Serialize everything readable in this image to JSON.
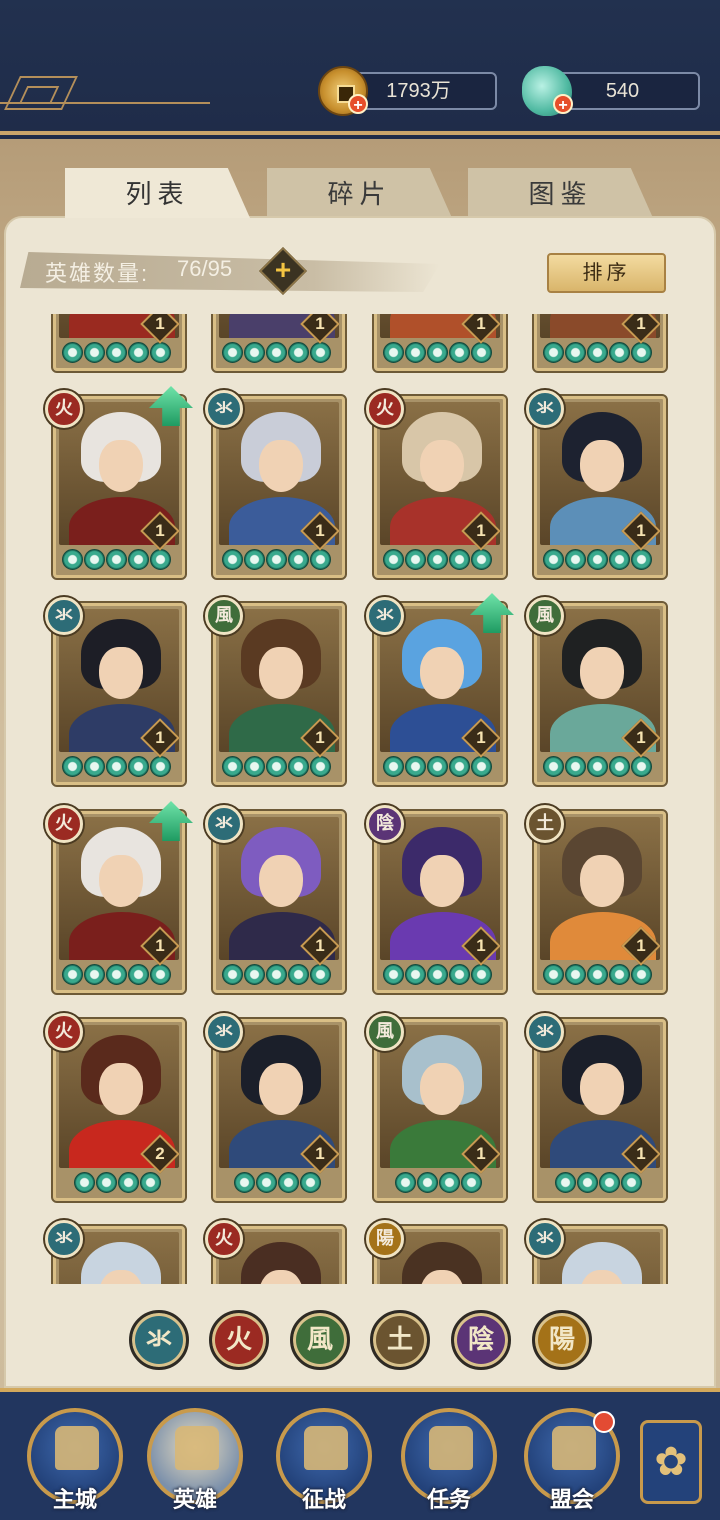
{
  "resources": {
    "coins": "1793万",
    "jade": "540"
  },
  "tabs": [
    "列表",
    "碎片",
    "图鉴"
  ],
  "hero_count": {
    "label": "英雄数量:",
    "value": "76/95"
  },
  "sort_label": "排序",
  "element_filters": [
    {
      "glyph": "氺",
      "name": "water",
      "color": "#2d6c77"
    },
    {
      "glyph": "火",
      "name": "fire",
      "color": "#9b2a22"
    },
    {
      "glyph": "風",
      "name": "wind",
      "color": "#3f6d3a"
    },
    {
      "glyph": "土",
      "name": "earth",
      "color": "#6b5430"
    },
    {
      "glyph": "陰",
      "name": "yin",
      "color": "#5b3476"
    },
    {
      "glyph": "陽",
      "name": "yang",
      "color": "#a47218"
    }
  ],
  "hero_rows": [
    [
      {
        "elem": "",
        "level": "1",
        "stars": 5,
        "upgrade": false,
        "hair": "#8a2a1f",
        "robe": "#9a2a20"
      },
      {
        "elem": "",
        "level": "1",
        "stars": 5,
        "upgrade": false,
        "hair": "#3b3555",
        "robe": "#4a3f6a"
      },
      {
        "elem": "",
        "level": "1",
        "stars": 5,
        "upgrade": false,
        "hair": "#c0612a",
        "robe": "#b0502a"
      },
      {
        "elem": "",
        "level": "1",
        "stars": 5,
        "upgrade": false,
        "hair": "#7a3a22",
        "robe": "#8a4a2a"
      }
    ],
    [
      {
        "elem": "fire",
        "level": "1",
        "stars": 5,
        "upgrade": true,
        "hair": "#e8e4df",
        "robe": "#7a1f1c"
      },
      {
        "elem": "water",
        "level": "1",
        "stars": 5,
        "upgrade": false,
        "hair": "#c9cdd8",
        "robe": "#3b5c9a"
      },
      {
        "elem": "fire",
        "level": "1",
        "stars": 5,
        "upgrade": false,
        "hair": "#d8c6a8",
        "robe": "#a8322a"
      },
      {
        "elem": "water",
        "level": "1",
        "stars": 5,
        "upgrade": false,
        "hair": "#1d2230",
        "robe": "#5c8fb8"
      }
    ],
    [
      {
        "elem": "water",
        "level": "1",
        "stars": 5,
        "upgrade": false,
        "hair": "#1d1e26",
        "robe": "#2e3c66"
      },
      {
        "elem": "wind",
        "level": "1",
        "stars": 5,
        "upgrade": false,
        "hair": "#5a3a22",
        "robe": "#2f6a48"
      },
      {
        "elem": "water",
        "level": "1",
        "stars": 5,
        "upgrade": true,
        "hair": "#5aa3e0",
        "robe": "#2d4f95"
      },
      {
        "elem": "wind",
        "level": "1",
        "stars": 5,
        "upgrade": false,
        "hair": "#1f2122",
        "robe": "#6aa89a"
      }
    ],
    [
      {
        "elem": "fire",
        "level": "1",
        "stars": 5,
        "upgrade": true,
        "hair": "#e8e4df",
        "robe": "#7a1f1c"
      },
      {
        "elem": "water",
        "level": "1",
        "stars": 5,
        "upgrade": false,
        "hair": "#7e5cc0",
        "robe": "#2f2a4a"
      },
      {
        "elem": "yin",
        "level": "1",
        "stars": 5,
        "upgrade": false,
        "hair": "#3c2a6a",
        "robe": "#6a3ab0"
      },
      {
        "elem": "earth",
        "level": "1",
        "stars": 5,
        "upgrade": false,
        "hair": "#5a4632",
        "robe": "#e08a3a"
      }
    ],
    [
      {
        "elem": "fire",
        "level": "2",
        "stars": 4,
        "upgrade": false,
        "hair": "#5a2a1c",
        "robe": "#c8281e"
      },
      {
        "elem": "water",
        "level": "1",
        "stars": 4,
        "upgrade": false,
        "hair": "#1b1f2a",
        "robe": "#2f4a7a"
      },
      {
        "elem": "wind",
        "level": "1",
        "stars": 4,
        "upgrade": false,
        "hair": "#a8c0cc",
        "robe": "#3a7a3a"
      },
      {
        "elem": "water",
        "level": "1",
        "stars": 4,
        "upgrade": false,
        "hair": "#1b1f2a",
        "robe": "#2f4a7a"
      }
    ],
    [
      {
        "elem": "water",
        "level": "",
        "stars": 0,
        "upgrade": false,
        "hair": "#c8d4e0",
        "robe": "#4a6a9a"
      },
      {
        "elem": "fire",
        "level": "",
        "stars": 0,
        "upgrade": false,
        "hair": "#4a2e22",
        "robe": "#7a2a22"
      },
      {
        "elem": "yang",
        "level": "",
        "stars": 0,
        "upgrade": false,
        "hair": "#4a3222",
        "robe": "#7a5a2a"
      },
      {
        "elem": "water",
        "level": "",
        "stars": 0,
        "upgrade": false,
        "hair": "#c8d4e0",
        "robe": "#4a6a9a"
      }
    ]
  ],
  "nav": [
    {
      "label": "主城",
      "icon": "city-icon"
    },
    {
      "label": "英雄",
      "icon": "hero-icon"
    },
    {
      "label": "征战",
      "icon": "battle-icon"
    },
    {
      "label": "任务",
      "icon": "quest-icon"
    },
    {
      "label": "盟会",
      "icon": "guild-icon"
    }
  ]
}
